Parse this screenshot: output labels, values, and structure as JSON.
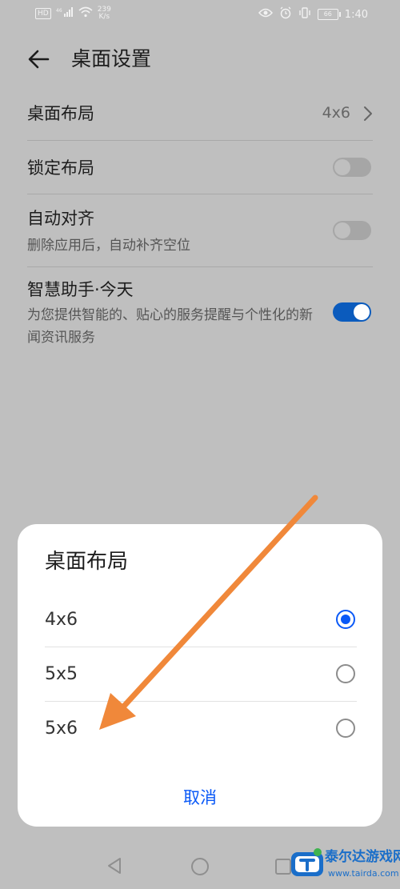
{
  "status_bar": {
    "network_badge": "HD",
    "signal": "46",
    "speed_value": "239",
    "speed_unit": "K/s",
    "battery": "66",
    "time": "1:40"
  },
  "header": {
    "title": "桌面设置"
  },
  "settings": {
    "layout": {
      "label": "桌面布局",
      "value": "4x6"
    },
    "lock_layout": {
      "label": "锁定布局",
      "enabled": false
    },
    "auto_align": {
      "label": "自动对齐",
      "description": "删除应用后，自动补齐空位",
      "enabled": false
    },
    "smart_assistant": {
      "label": "智慧助手·今天",
      "description": "为您提供智能的、贴心的服务提醒与个性化的新闻资讯服务",
      "enabled": true
    }
  },
  "dialog": {
    "title": "桌面布局",
    "options": [
      {
        "label": "4x6",
        "selected": true
      },
      {
        "label": "5x5",
        "selected": false
      },
      {
        "label": "5x6",
        "selected": false
      }
    ],
    "cancel_label": "取消"
  },
  "annotation": {
    "color": "#f0883a"
  },
  "watermark": {
    "text": "泰尔达游戏网",
    "url": "www.tairda.com"
  },
  "colors": {
    "accent": "#0a59f7",
    "toggle_on": "#0b5bbd",
    "dim_background": "#bfbfbf"
  }
}
